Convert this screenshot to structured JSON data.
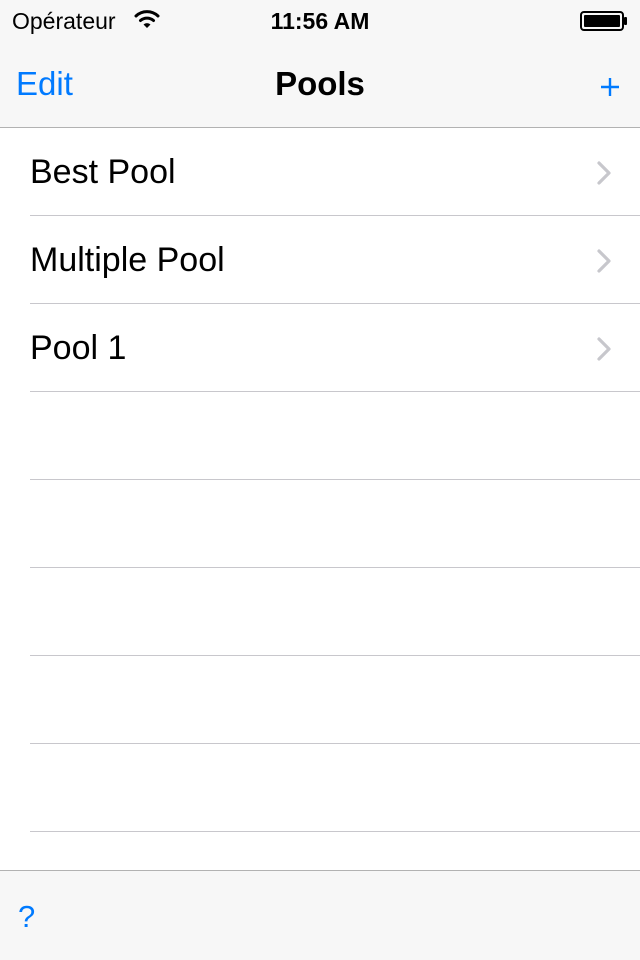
{
  "status_bar": {
    "carrier": "Opérateur",
    "time": "11:56 AM",
    "wifi_icon": "wifi-icon",
    "battery_icon": "battery-icon"
  },
  "nav": {
    "edit_label": "Edit",
    "title": "Pools",
    "add_icon": "plus-icon"
  },
  "pools": [
    {
      "label": "Best Pool"
    },
    {
      "label": "Multiple Pool"
    },
    {
      "label": "Pool 1"
    }
  ],
  "toolbar": {
    "help_label": "?"
  },
  "colors": {
    "accent": "#007aff",
    "bar_background": "#f7f7f7",
    "separator": "#c8c7cc",
    "chevron": "#c7c7cc"
  }
}
